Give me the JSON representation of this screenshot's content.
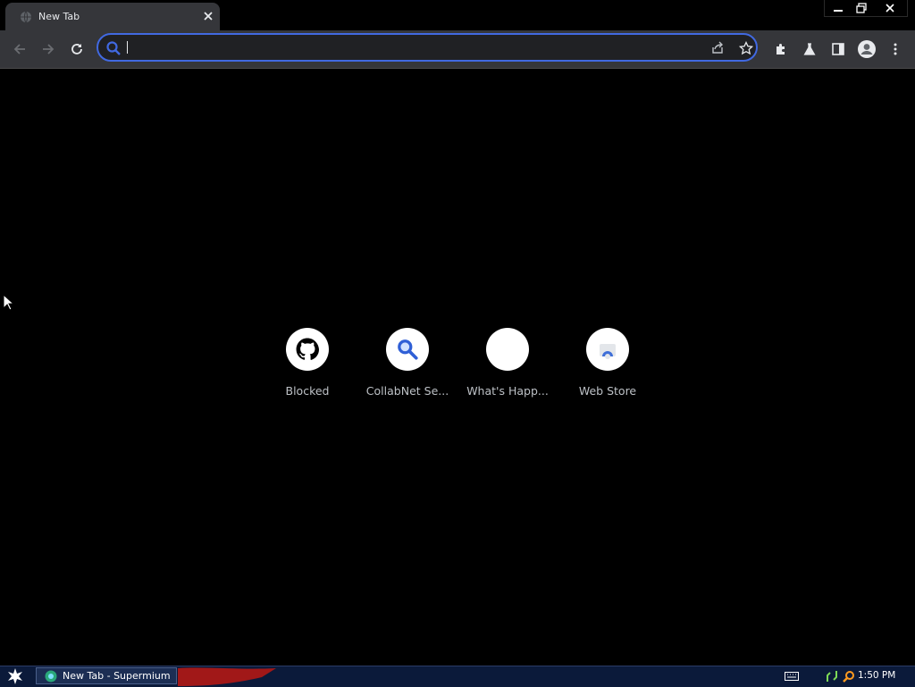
{
  "window": {
    "tab_title": "New Tab",
    "tab_favicon": "globe-icon",
    "controls": [
      "minimize-icon",
      "restore-icon",
      "close-icon"
    ]
  },
  "toolbar": {
    "back": "arrow-left-icon",
    "forward": "arrow-right-icon",
    "reload": "reload-icon",
    "omnibox": {
      "value": "",
      "placeholder": ""
    },
    "omnibox_icons": [
      "share-icon",
      "star-icon"
    ],
    "extras": [
      "puzzle-icon",
      "flask-icon",
      "side-panel-icon",
      "profile-icon",
      "kebab-menu-icon"
    ]
  },
  "shortcuts": [
    {
      "label": "Blocked",
      "icon": "github-icon"
    },
    {
      "label": "CollabNet Se...",
      "icon": "search-icon"
    },
    {
      "label": "What's Happ...",
      "icon": "blank-icon"
    },
    {
      "label": "Web Store",
      "icon": "web-store-icon"
    }
  ],
  "taskbar": {
    "start_icon": "star-burst-icon",
    "task_label": "New Tab - Supermium",
    "tray_icons": [
      "keyboard-icon",
      "network-icon",
      "search-tray-icon"
    ],
    "clock": "1:50 PM"
  },
  "colors": {
    "accent": "#4169e1",
    "toolbar_bg": "#35363a",
    "page_bg": "#000000",
    "taskbar_bg": "#0b1a3a"
  }
}
